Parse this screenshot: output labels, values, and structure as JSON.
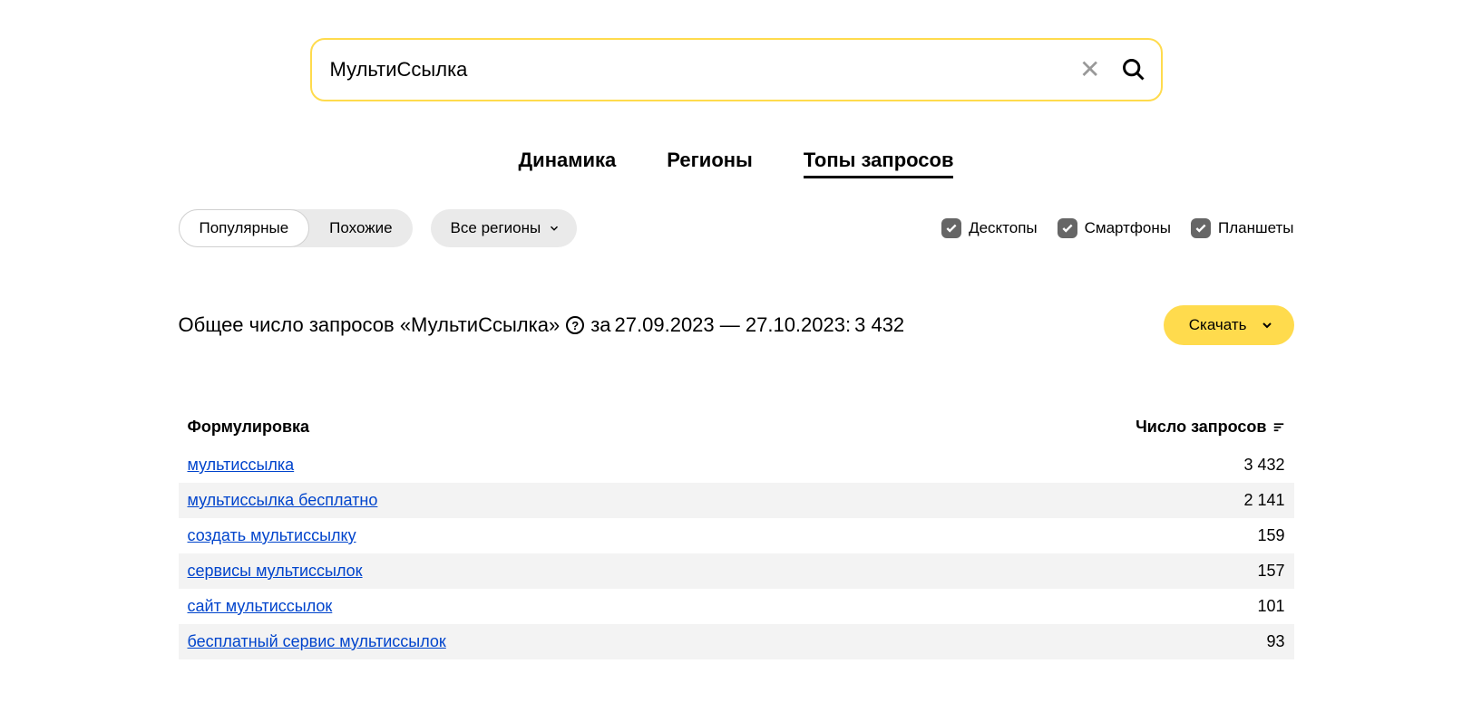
{
  "search": {
    "value": "МультиСсылка"
  },
  "tabs": [
    {
      "label": "Динамика",
      "active": false
    },
    {
      "label": "Регионы",
      "active": false
    },
    {
      "label": "Топы запросов",
      "active": true
    }
  ],
  "segmented": {
    "popular": "Популярные",
    "similar": "Похожие"
  },
  "region_select": "Все регионы",
  "device_checks": {
    "desktops": "Десктопы",
    "smartphones": "Смартфоны",
    "tablets": "Планшеты"
  },
  "summary": {
    "prefix": "Общее число запросов «МультиСсылка»",
    "period_prefix": "за",
    "period": "27.09.2023 — 27.10.2023:",
    "total": "3 432"
  },
  "download_label": "Скачать",
  "table": {
    "col_query": "Формулировка",
    "col_count": "Число запросов",
    "rows": [
      {
        "query": "мультиссылка",
        "count": "3 432"
      },
      {
        "query": "мультиссылка бесплатно",
        "count": "2 141"
      },
      {
        "query": "создать мультиссылку",
        "count": "159"
      },
      {
        "query": "сервисы мультиссылок",
        "count": "157"
      },
      {
        "query": "сайт мультиссылок",
        "count": "101"
      },
      {
        "query": "бесплатный сервис мультиссылок",
        "count": "93"
      }
    ]
  }
}
